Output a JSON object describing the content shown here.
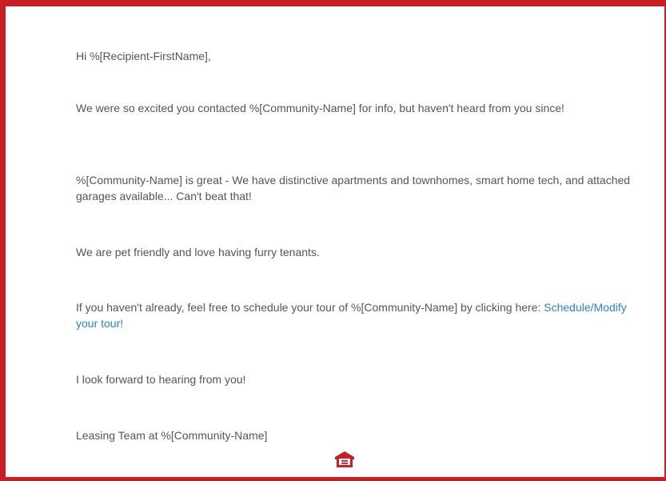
{
  "email": {
    "greeting": "Hi %[Recipient-FirstName],",
    "para1": "We were so excited you contacted %[Community-Name] for info, but haven't heard from you since!",
    "para2": "%[Community-Name] is great - We have distinctive apartments and townhomes, smart home tech, and attached garages available... Can't beat that!",
    "para3": "We are pet friendly and love having furry tenants.",
    "para4_text": "If you haven't already, feel free to schedule your tour of %[Community-Name] by clicking here: ",
    "para4_link": "Schedule/Modify your tour!",
    "para5": "I look forward to hearing from you!",
    "signature": "Leasing Team at %[Community-Name]"
  },
  "footer": {
    "icon": "equal-housing-opportunity-icon",
    "icon_color": "#c81e24"
  },
  "colors": {
    "border": "#c81e24",
    "text": "#555555",
    "link": "#2a86b8"
  }
}
